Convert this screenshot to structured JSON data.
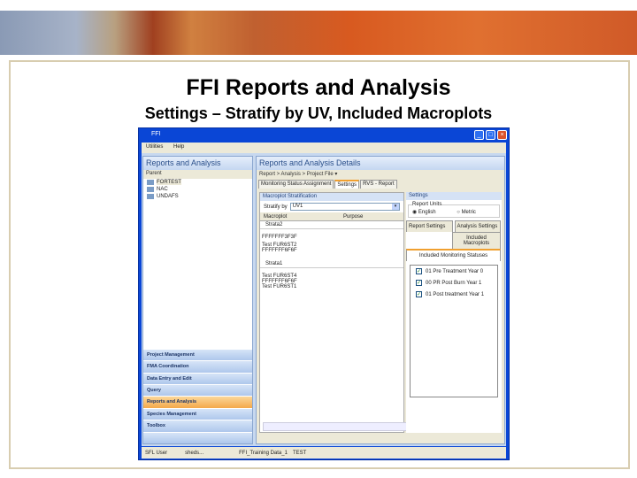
{
  "slide": {
    "title": "FFI Reports and Analysis",
    "subtitle": "Settings – Stratify by UV, Included Macroplots"
  },
  "window": {
    "title": "FFI",
    "menu": [
      "Utilities",
      "Help"
    ]
  },
  "left_pane": {
    "header": "Reports and Analysis",
    "subheader": "Parent",
    "tree": [
      "FORTEST",
      "NAC",
      "UNDAFS"
    ],
    "nav": [
      "Project Management",
      "FMA Coordination",
      "Data Entry and Edit",
      "Query",
      "Reports and Analysis",
      "Species Management",
      "Toolbox"
    ],
    "active_nav": "Reports and Analysis"
  },
  "right_pane": {
    "header": "Reports and Analysis Details",
    "breadcrumb": "Report > Analysis > Project File ▾",
    "tabs": [
      "Monitoring Status Assignment",
      "Settings",
      "RVS - Report"
    ],
    "active_tab": "Settings",
    "stratification": {
      "section": "Macroplot Stratification",
      "stratify_label": "Stratify by",
      "stratify_value": "UV1",
      "columns": [
        "Macroplot",
        "Purpose"
      ],
      "groups": [
        {
          "name": "Strata2",
          "plots": [
            "FFFFFFF3F3F",
            "Test FUR6ST2",
            "FFFFFFF6F6F"
          ]
        },
        {
          "name": "Strata1",
          "plots": [
            "Test FUR6ST4",
            "FFFFFFF6F6F",
            "Test FUR6ST1"
          ]
        }
      ]
    },
    "settings": {
      "section": "Settings",
      "report_units_label": "Report Units",
      "units": [
        "English",
        "Metric"
      ],
      "selected_unit": "English",
      "subtabs": [
        "Report Settings",
        "Analysis Settings"
      ],
      "included_macroplots": "Included Macroplots",
      "included_statuses": "Included Monitoring Statuses",
      "statuses": [
        {
          "label": "01 Pre Treatment Year 0",
          "checked": true
        },
        {
          "label": "00 PR Post Burn Year 1",
          "checked": true
        },
        {
          "label": "01 Post treatment Year 1",
          "checked": true
        }
      ]
    }
  },
  "status_bar": [
    "SFL User",
    "sheds...",
    "FFI_Training Data_1",
    "TEST"
  ]
}
